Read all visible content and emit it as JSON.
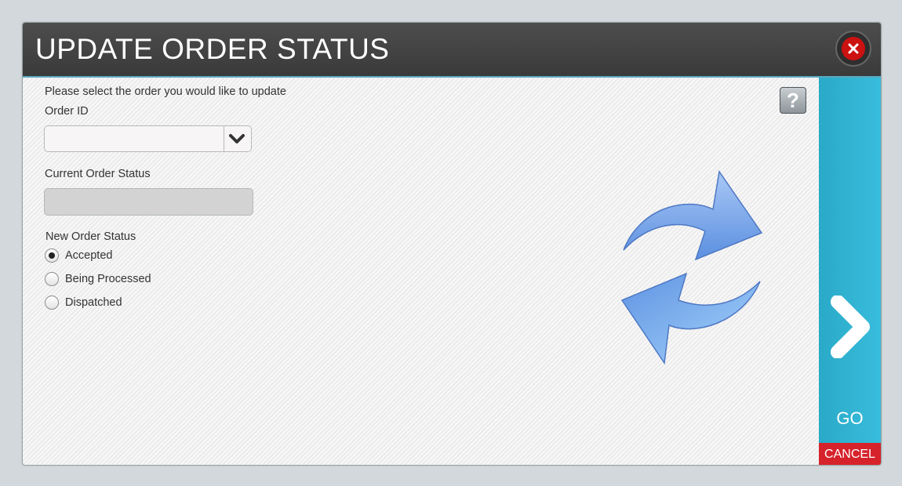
{
  "dialog": {
    "title": "UPDATE ORDER STATUS",
    "close_icon": "close-icon"
  },
  "form": {
    "intro": "Please select the order you would like to update",
    "order_id_label": "Order ID",
    "order_id_value": "",
    "current_status_label": "Current Order Status",
    "current_status_value": "",
    "new_status_label": "New Order Status",
    "options": [
      {
        "label": "Accepted",
        "selected": true
      },
      {
        "label": "Being Processed",
        "selected": false
      },
      {
        "label": "Dispatched",
        "selected": false
      }
    ]
  },
  "help": {
    "icon": "help-icon",
    "glyph": "?"
  },
  "illustration": {
    "icon": "refresh-icon"
  },
  "actions": {
    "go_label": "GO",
    "cancel_label": "CANCEL"
  },
  "colors": {
    "title_bar": "#404040",
    "go_button": "#2fb3d2",
    "cancel_button": "#d6232b",
    "close_button": "#cc1111"
  }
}
